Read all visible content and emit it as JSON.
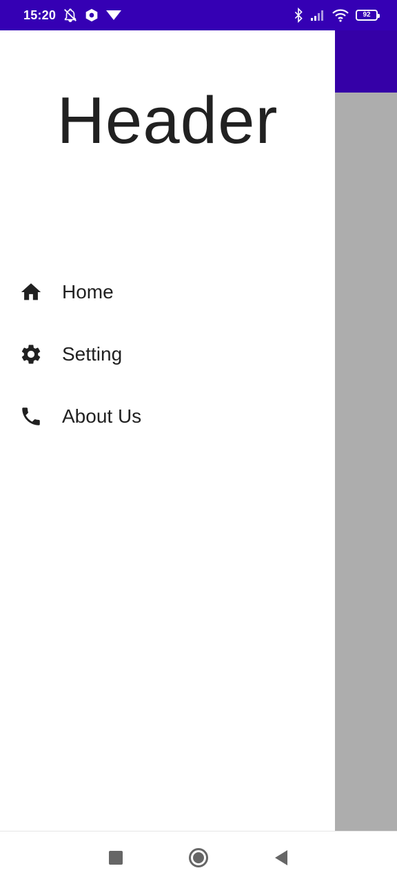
{
  "status_bar": {
    "time": "15:20",
    "battery": "92",
    "icons": [
      "bell-off-icon",
      "app-notification-icon",
      "dropdown-triangle-icon",
      "bluetooth-icon",
      "signal-icon",
      "wifi-icon",
      "battery-icon"
    ]
  },
  "drawer": {
    "header_title": "Header",
    "items": [
      {
        "label": "Home",
        "icon": "home-icon"
      },
      {
        "label": "Setting",
        "icon": "gear-icon"
      },
      {
        "label": "About Us",
        "icon": "phone-icon"
      }
    ]
  },
  "nav_bar": {
    "buttons": [
      "recent-apps",
      "home",
      "back"
    ]
  },
  "colors": {
    "status_bar": "#3500b4",
    "toolbar": "#3500a7",
    "scrim": "#adadad",
    "text": "#212121"
  }
}
